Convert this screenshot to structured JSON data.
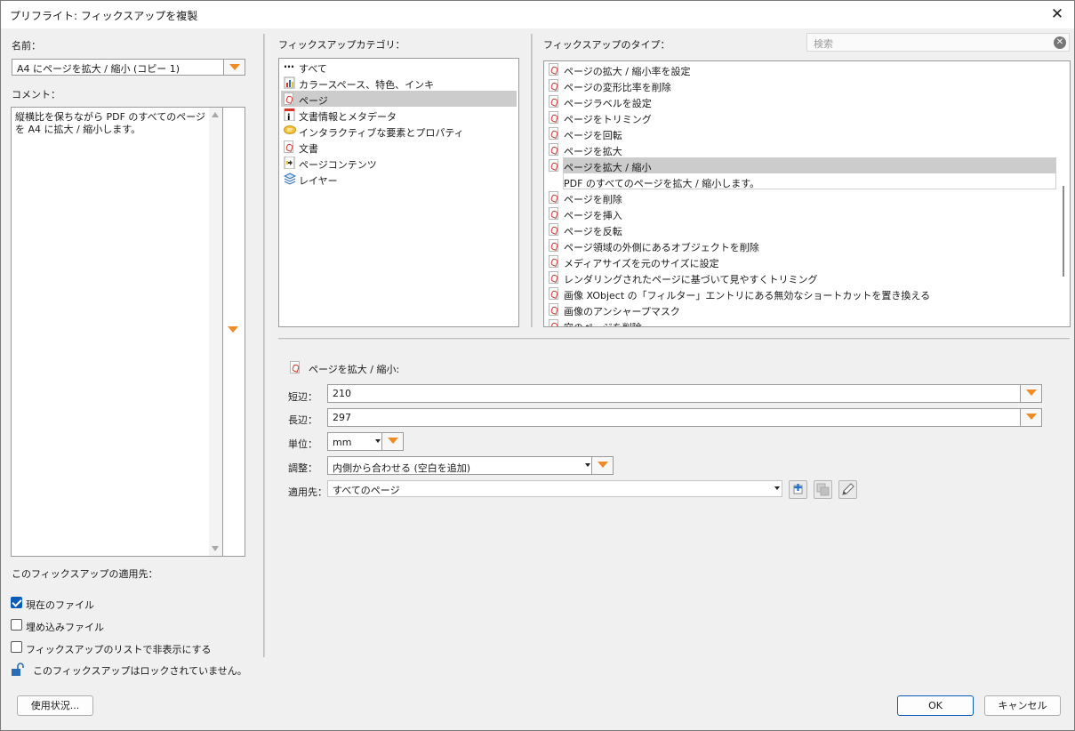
{
  "window": {
    "title": "プリフライト: フィックスアップを複製",
    "close_glyph": "✕"
  },
  "left": {
    "name_label": "名前：",
    "name_value": "A4 にページを拡大 / 縮小 (コピー 1)",
    "comment_label": "コメント：",
    "comment_text": "縦横比を保ちながら PDF のすべてのページを A4 に拡大 / 縮小します。",
    "applies_to_label": "このフィックスアップの適用先：",
    "checkboxes": [
      {
        "label": "現在のファイル",
        "checked": true
      },
      {
        "label": "埋め込みファイル",
        "checked": false
      },
      {
        "label": "フィックスアップのリストで非表示にする",
        "checked": false
      }
    ],
    "lock_text": "このフィックスアップはロックされていません。",
    "usage_button": "使用状況..."
  },
  "categories": {
    "label": "フィックスアップカテゴリ：",
    "items": [
      {
        "label": "すべて",
        "icon": "ellipsis-icon"
      },
      {
        "label": "カラースペース、特色、インキ",
        "icon": "color-chart-icon"
      },
      {
        "label": "ページ",
        "icon": "pdf-page-icon",
        "selected": true
      },
      {
        "label": "文書情報とメタデータ",
        "icon": "info-icon"
      },
      {
        "label": "インタラクティブな要素とプロパティ",
        "icon": "comment-bubble-icon"
      },
      {
        "label": "文書",
        "icon": "pdf-document-icon"
      },
      {
        "label": "ページコンテンツ",
        "icon": "page-content-icon"
      },
      {
        "label": "レイヤー",
        "icon": "layers-icon"
      }
    ]
  },
  "types": {
    "label": "フィックスアップのタイプ：",
    "search_placeholder": "検索",
    "items": [
      "ページの拡大 / 縮小率を設定",
      "ページの変形比率を削除",
      "ページラベルを設定",
      "ページをトリミング",
      "ページを回転",
      "ページを拡大",
      "ページを拡大 / 縮小",
      "PDF のすべてのページを拡大 / 縮小します。",
      "ページを削除",
      "ページを挿入",
      "ページを反転",
      "ページ領域の外側にあるオブジェクトを削除",
      "メディアサイズを元のサイズに設定",
      "レンダリングされたページに基づいて見やすくトリミング",
      "画像 XObject の「フィルター」エントリにある無効なショートカットを置き換える",
      "画像のアンシャープマスク",
      "空のページを削除"
    ],
    "selected_index": 6,
    "description_index": 7
  },
  "detail": {
    "heading": "ページを拡大 / 縮小:",
    "short_label": "短辺：",
    "short_value": "210",
    "long_label": "長辺：",
    "long_value": "297",
    "unit_label": "単位：",
    "unit_value": "mm",
    "fit_label": "調整：",
    "fit_value": "内側から合わせる (空白を追加)",
    "apply_label": "適用先：",
    "apply_value": "すべてのページ"
  },
  "buttons": {
    "ok": "OK",
    "cancel": "キャンセル"
  },
  "colors": {
    "accent_orange": "#f08a24",
    "selection": "#cccccc",
    "check_blue": "#0a5cba",
    "pdf_red": "#d6332a"
  }
}
